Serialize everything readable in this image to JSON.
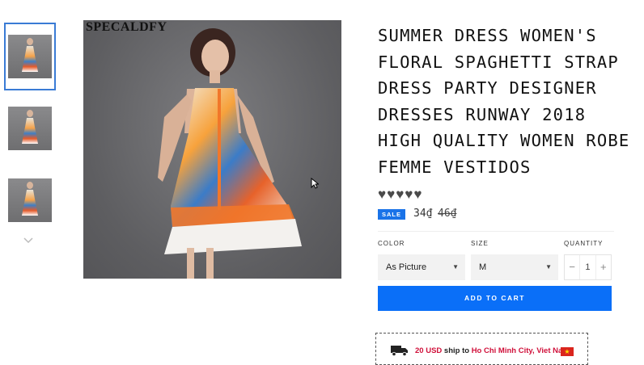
{
  "gallery": {
    "watermark": "SPECALDFY",
    "thumbnails": [
      {
        "label": "thumbnail-1",
        "active": true
      },
      {
        "label": "thumbnail-2",
        "active": false
      },
      {
        "label": "thumbnail-3",
        "active": false
      }
    ]
  },
  "product": {
    "title": "SUMMER DRESS WOMEN'S FLORAL SPAGHETTI STRAP DRESS PARTY DESIGNER DRESSES RUNWAY 2018 HIGH QUALITY WOMEN ROBE FEMME VESTIDOS",
    "rating_hearts": 5,
    "sale_badge": "SALE",
    "price": "34₫",
    "compare_price": "46₫"
  },
  "options": {
    "color_label": "COLOR",
    "color_value": "As Picture",
    "size_label": "SIZE",
    "size_value": "M",
    "quantity_label": "QUANTITY",
    "quantity_value": "1",
    "minus": "−",
    "plus": "+"
  },
  "cart": {
    "add_label": "ADD TO CART"
  },
  "shipping": {
    "amount": "20 USD",
    "text_mid": "ship to",
    "destination": "Ho Chi Minh City, Viet Nam",
    "flag": "★"
  },
  "colors": {
    "accent": "#0a6ff8",
    "sale": "#1a73e8",
    "highlight": "#d0103a"
  }
}
